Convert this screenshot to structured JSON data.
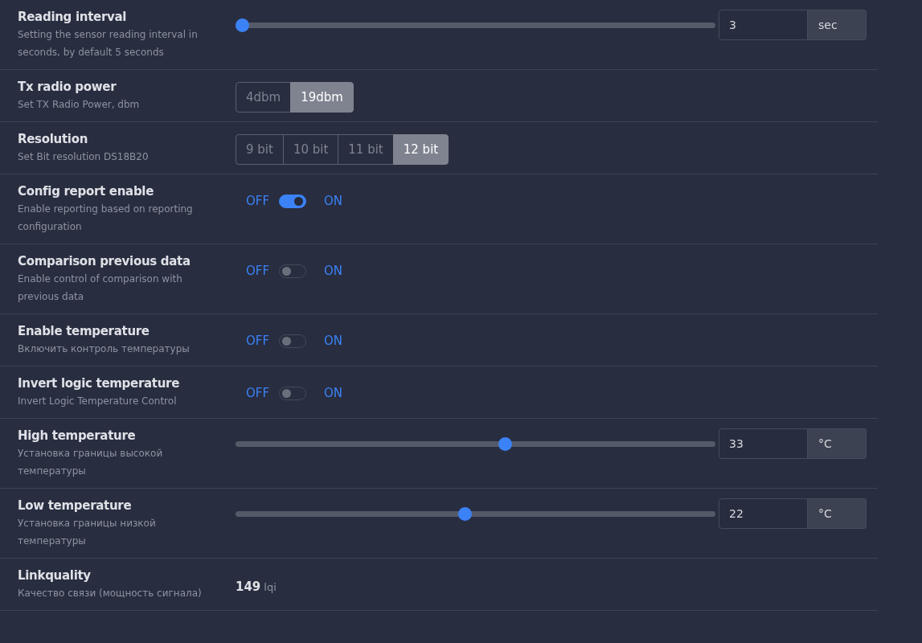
{
  "settings": [
    {
      "kind": "slider",
      "title": "Reading interval",
      "description": "Setting the sensor reading interval in seconds, by default 5 seconds",
      "level": 0,
      "value": "3",
      "unit": "sec"
    },
    {
      "kind": "radio",
      "title": "Tx radio power",
      "description": "Set TX Radio Power, dbm",
      "options": [
        {
          "label": "4dbm",
          "selected": false
        },
        {
          "label": "19dbm",
          "selected": true
        }
      ]
    },
    {
      "kind": "radio",
      "title": "Resolution",
      "description": "Set Bit resolution DS18B20",
      "options": [
        {
          "label": "9 bit",
          "selected": false
        },
        {
          "label": "10 bit",
          "selected": false
        },
        {
          "label": "11 bit",
          "selected": false
        },
        {
          "label": "12 bit",
          "selected": true
        }
      ]
    },
    {
      "kind": "toggle",
      "title": "Config report enable",
      "description": "Enable reporting based on reporting configuration",
      "off_label": "OFF",
      "on_label": "ON",
      "on": true
    },
    {
      "kind": "toggle",
      "title": "Comparison previous data",
      "description": "Enable control of comparison with previous data",
      "off_label": "OFF",
      "on_label": "ON",
      "on": false
    },
    {
      "kind": "toggle",
      "title": "Enable temperature",
      "description": "Включить контроль температуры",
      "off_label": "OFF",
      "on_label": "ON",
      "on": false
    },
    {
      "kind": "toggle",
      "title": "Invert logic temperature",
      "description": "Invert Logic Temperature Control",
      "off_label": "OFF",
      "on_label": "ON",
      "on": false
    },
    {
      "kind": "slider",
      "title": "High temperature",
      "description": "Установка границы высокой температуры",
      "level": 0.562,
      "value": "33",
      "unit": "°C"
    },
    {
      "kind": "slider",
      "title": "Low temperature",
      "description": "Установка границы низкой температуры",
      "level": 0.476,
      "value": "22",
      "unit": "°C"
    },
    {
      "kind": "value",
      "title": "Linkquality",
      "description": "Качество связи (мощность сигнала)",
      "value": "149",
      "unit": "lqi"
    }
  ]
}
